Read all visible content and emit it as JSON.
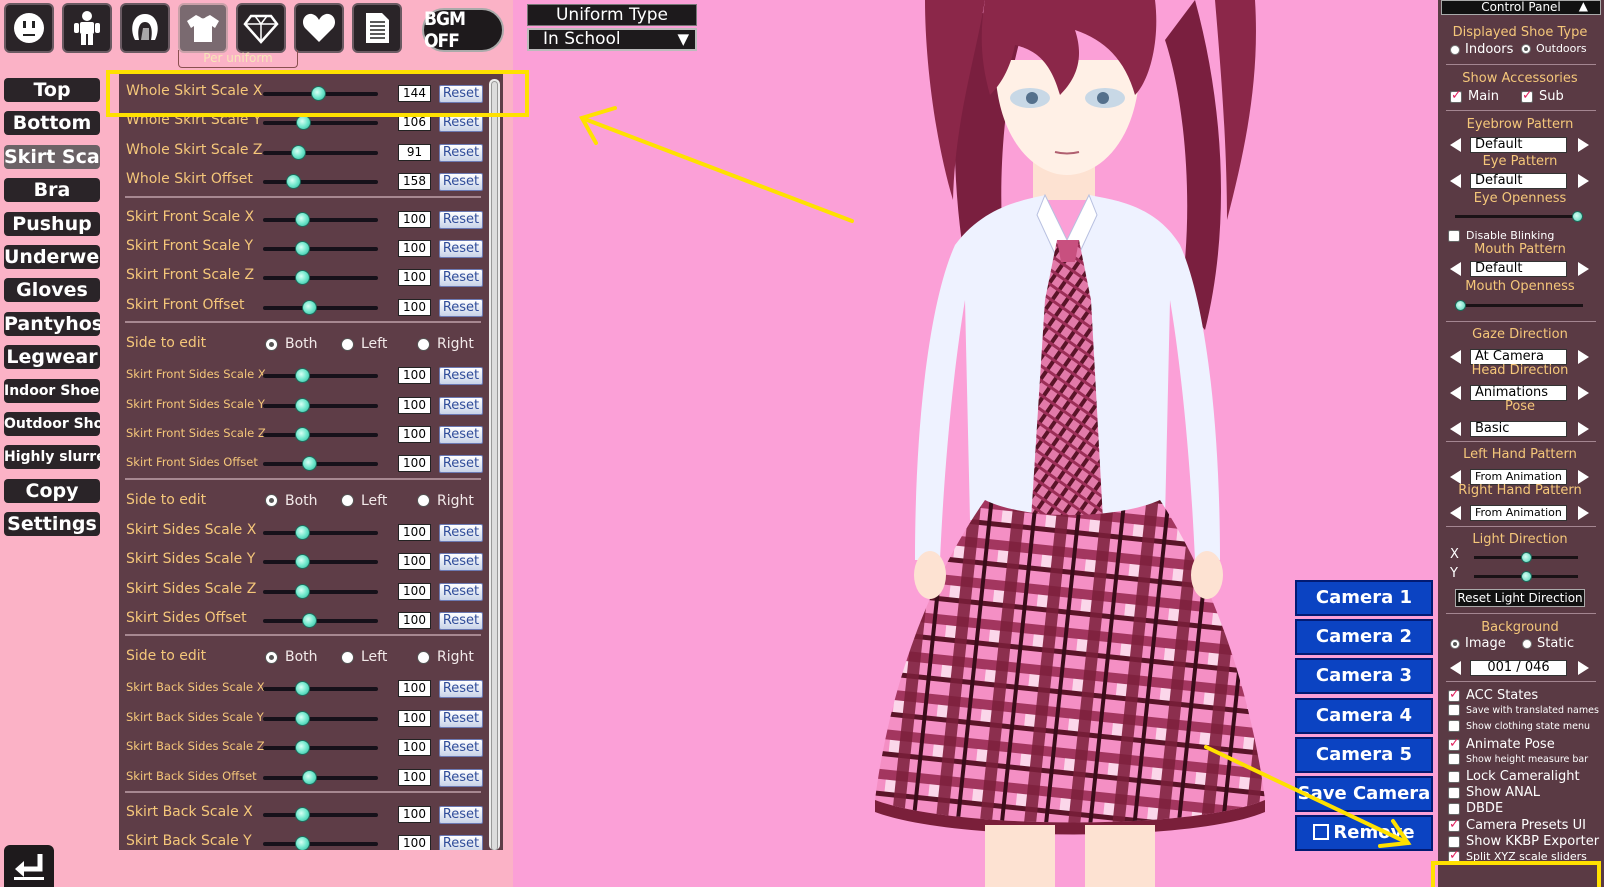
{
  "toolbar": {
    "buttons": [
      {
        "name": "face-tab",
        "icon": "face-icon"
      },
      {
        "name": "body-tab",
        "icon": "body-icon"
      },
      {
        "name": "hair-tab",
        "icon": "hair-icon"
      },
      {
        "name": "clothing-tab",
        "icon": "shirt-icon",
        "active": true
      },
      {
        "name": "accessories-tab",
        "icon": "diamond-icon"
      },
      {
        "name": "favorite-tab",
        "icon": "heart-icon"
      },
      {
        "name": "file-tab",
        "icon": "document-icon"
      }
    ],
    "per_uniform_label": "Per uniform",
    "bgm_label": "BGM OFF"
  },
  "categories": [
    {
      "label": "Top"
    },
    {
      "label": "Bottom"
    },
    {
      "label": "Skirt Scale",
      "active": true
    },
    {
      "label": "Bra"
    },
    {
      "label": "Pushup"
    },
    {
      "label": "Underwear"
    },
    {
      "label": "Gloves"
    },
    {
      "label": "Pantyhose"
    },
    {
      "label": "Legwear"
    },
    {
      "label": "Indoor Shoes",
      "small": true
    },
    {
      "label": "Outdoor Shoes",
      "small": true
    },
    {
      "label": "Highly slurred",
      "small": true
    },
    {
      "label": "Copy"
    },
    {
      "label": "Settings"
    }
  ],
  "uniform": {
    "title": "Uniform Type",
    "selected": "In School",
    "arrow": "▼"
  },
  "panel": {
    "reset_label": "Reset",
    "side_label": "Side to edit",
    "side_options": [
      "Both",
      "Left",
      "Right"
    ],
    "groups": [
      {
        "sliders": [
          {
            "label": "Whole Skirt Scale X",
            "value": "144",
            "fraction": 0.48
          },
          {
            "label": "Whole Skirt Scale Y",
            "value": "106",
            "fraction": 0.35
          },
          {
            "label": "Whole Skirt Scale Z",
            "value": "91",
            "fraction": 0.3
          },
          {
            "label": "Whole Skirt Offset",
            "value": "158",
            "fraction": 0.26
          }
        ]
      },
      {
        "sliders": [
          {
            "label": "Skirt Front Scale X",
            "value": "100",
            "fraction": 0.34
          },
          {
            "label": "Skirt Front Scale Y",
            "value": "100",
            "fraction": 0.34
          },
          {
            "label": "Skirt Front Scale Z",
            "value": "100",
            "fraction": 0.34
          },
          {
            "label": "Skirt Front Offset",
            "value": "100",
            "fraction": 0.4
          }
        ]
      },
      {
        "side": true,
        "sliders": [
          {
            "label": "Skirt Front Sides Scale X",
            "value": "100",
            "fraction": 0.34,
            "small": true
          },
          {
            "label": "Skirt Front Sides Scale Y",
            "value": "100",
            "fraction": 0.34,
            "small": true
          },
          {
            "label": "Skirt Front Sides Scale Z",
            "value": "100",
            "fraction": 0.34,
            "small": true
          },
          {
            "label": "Skirt Front Sides Offset",
            "value": "100",
            "fraction": 0.4,
            "small": true
          }
        ]
      },
      {
        "side": true,
        "sliders": [
          {
            "label": "Skirt Sides Scale X",
            "value": "100",
            "fraction": 0.34
          },
          {
            "label": "Skirt Sides Scale Y",
            "value": "100",
            "fraction": 0.34
          },
          {
            "label": "Skirt Sides Scale Z",
            "value": "100",
            "fraction": 0.34
          },
          {
            "label": "Skirt Sides Offset",
            "value": "100",
            "fraction": 0.4
          }
        ]
      },
      {
        "side": true,
        "sliders": [
          {
            "label": "Skirt Back Sides Scale X",
            "value": "100",
            "fraction": 0.34,
            "small": true
          },
          {
            "label": "Skirt Back Sides Scale Y",
            "value": "100",
            "fraction": 0.34,
            "small": true
          },
          {
            "label": "Skirt Back Sides Scale Z",
            "value": "100",
            "fraction": 0.34,
            "small": true
          },
          {
            "label": "Skirt Back Sides Offset",
            "value": "100",
            "fraction": 0.4,
            "small": true
          }
        ]
      },
      {
        "sliders": [
          {
            "label": "Skirt Back Scale X",
            "value": "100",
            "fraction": 0.34
          },
          {
            "label": "Skirt Back Scale Y",
            "value": "100",
            "fraction": 0.34
          }
        ]
      }
    ]
  },
  "cameras": [
    "Camera 1",
    "Camera 2",
    "Camera 3",
    "Camera 4",
    "Camera 5",
    "Save Camera",
    "Remove"
  ],
  "control_panel": {
    "title": "Control Panel",
    "title_arrow": "▲",
    "shoe_type": {
      "title": "Displayed Shoe Type",
      "options": [
        "Indoors",
        "Outdoors"
      ],
      "selected": "Outdoors"
    },
    "accessories": {
      "title": "Show Accessories",
      "main": "Main",
      "sub": "Sub"
    },
    "eyebrow": {
      "title": "Eyebrow Pattern",
      "value": "Default"
    },
    "eye": {
      "title": "Eye Pattern",
      "value": "Default"
    },
    "eye_openness": {
      "title": "Eye Openness",
      "level": 1.0
    },
    "disable_blinking": "Disable Blinking",
    "mouth": {
      "title": "Mouth Pattern",
      "value": "Default"
    },
    "mouth_openness": {
      "title": "Mouth Openness",
      "level": 0.0
    },
    "gaze": {
      "title": "Gaze Direction",
      "value": "At Camera"
    },
    "head": {
      "title": "Head Direction",
      "value": "Animations"
    },
    "pose": {
      "title": "Pose",
      "value": "Basic"
    },
    "left_hand": {
      "title": "Left Hand Pattern",
      "value": "From Animation"
    },
    "right_hand": {
      "title": "Right Hand Pattern",
      "value": "From Animation"
    },
    "light": {
      "title": "Light Direction",
      "x_label": "X",
      "y_label": "Y",
      "x_level": 0.5,
      "y_level": 0.5,
      "reset": "Reset Light Direction"
    },
    "background": {
      "title": "Background",
      "options": [
        "Image",
        "Static"
      ],
      "selected": "Image",
      "counter": "001 / 046"
    },
    "checks": [
      {
        "label": "ACC States",
        "checked": true,
        "size": "lg"
      },
      {
        "label": "Save with translated names",
        "checked": false,
        "size": "sm"
      },
      {
        "label": "Show clothing state menu",
        "checked": false,
        "size": "sm"
      },
      {
        "label": "Animate Pose",
        "checked": true,
        "size": "lg"
      },
      {
        "label": "Show height measure bar",
        "checked": false,
        "size": "sm"
      },
      {
        "label": "Lock Cameralight",
        "checked": false,
        "size": "lg"
      },
      {
        "label": "Show ANAL",
        "checked": false,
        "size": "lg"
      },
      {
        "label": "DBDE",
        "checked": false,
        "size": "lg"
      },
      {
        "label": "Camera Presets UI",
        "checked": true,
        "size": "lg"
      },
      {
        "label": "Show KKBP Exporter",
        "checked": false,
        "size": "lg"
      },
      {
        "label": "Split XYZ scale sliders",
        "checked": true,
        "size": "md"
      }
    ]
  },
  "colors": {
    "annotation": "#ffe100",
    "background": "#fba0d7",
    "panel": "#5e3d47",
    "label": "#f5c77a",
    "camera": "#0b43c2"
  }
}
